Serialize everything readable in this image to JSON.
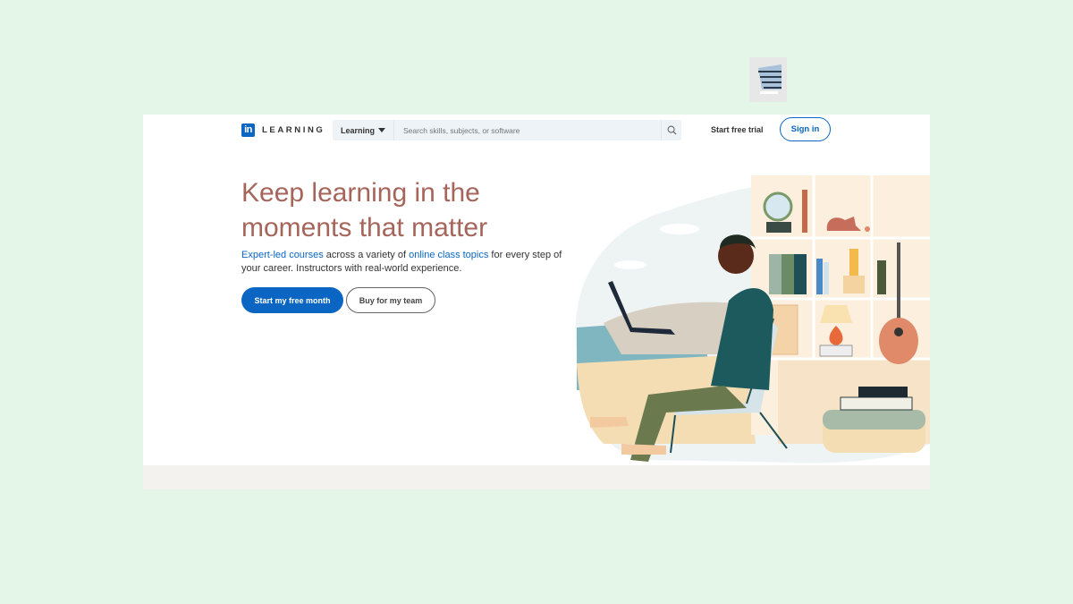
{
  "header": {
    "logo_mark": "in",
    "logo_text": "LEARNING",
    "search_scope": "Learning",
    "search_placeholder": "Search skills, subjects, or software",
    "start_trial_label": "Start free trial",
    "sign_in_label": "Sign in"
  },
  "hero": {
    "title": "Keep learning in the moments that matter",
    "sub_link1": "Expert-led courses",
    "sub_text1": " across a variety of ",
    "sub_link2": "online class topics",
    "sub_text2": " for every step of your career. Instructors with real-world experience.",
    "primary_button": "Start my free month",
    "secondary_button": "Buy for my team"
  },
  "illustration": {
    "description": "man-with-laptop-in-chair-beside-bookshelf",
    "icons": [
      "globe",
      "cat",
      "binders",
      "lamp",
      "guitar",
      "books",
      "laptop",
      "chair"
    ]
  },
  "colors": {
    "brand": "#0a66c2",
    "title": "#a6655a",
    "background": "#e3f6e8"
  }
}
